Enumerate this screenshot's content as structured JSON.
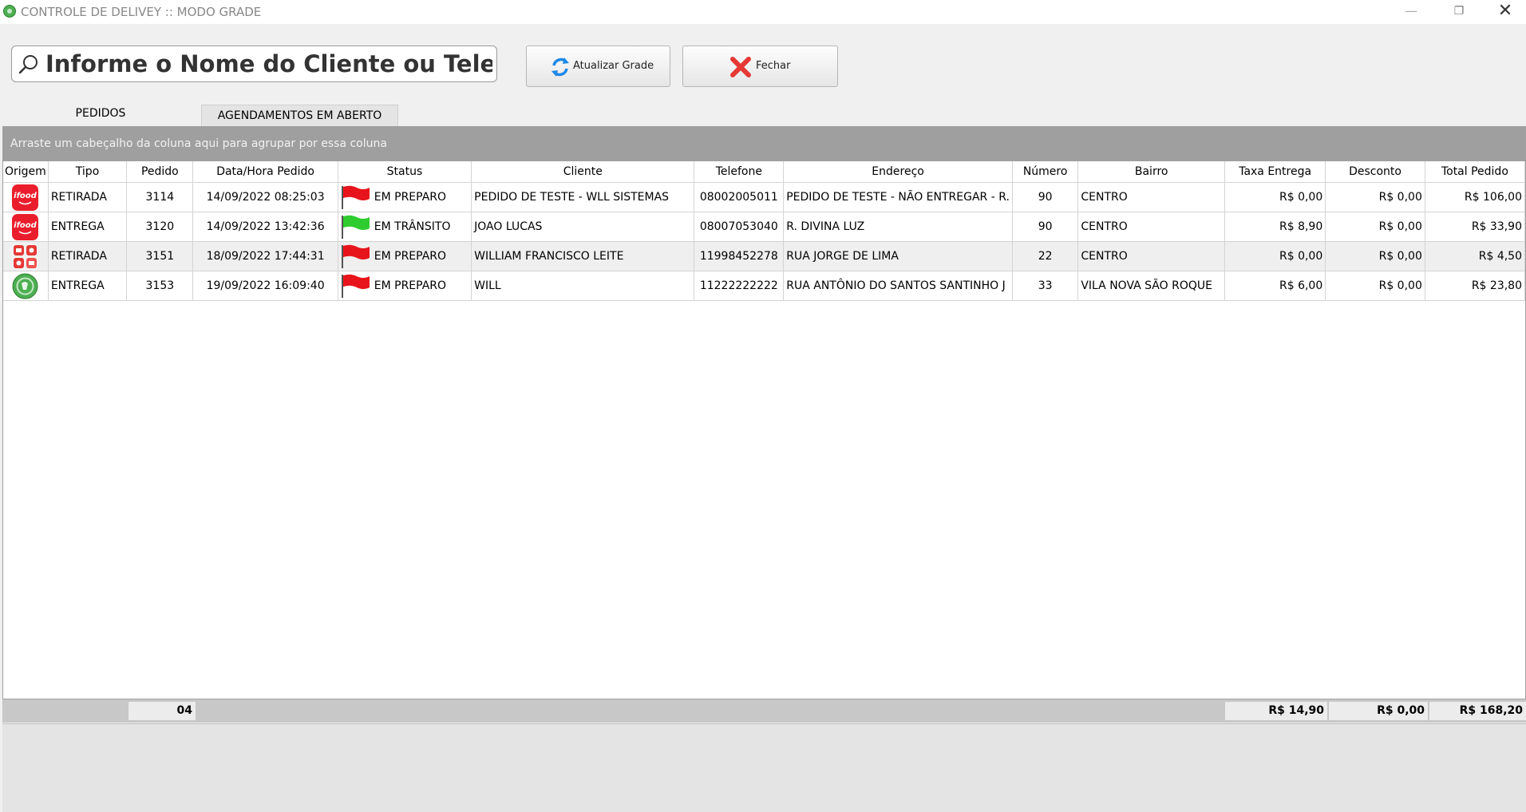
{
  "window": {
    "title": "CONTROLE DE DELIVEY :: MODO GRADE",
    "minimize": "—",
    "maximize": "❐",
    "close": "✕"
  },
  "toolbar": {
    "search_placeholder": "Informe o Nome do Cliente ou Telefone",
    "refresh_label": "Atualizar Grade",
    "close_label": "Fechar"
  },
  "tabs": [
    {
      "label": "PEDIDOS",
      "active": true
    },
    {
      "label": "AGENDAMENTOS EM ABERTO",
      "active": false
    }
  ],
  "grid": {
    "group_hint": "Arraste um cabeçalho da coluna aqui para agrupar por essa coluna",
    "columns": [
      "Origem",
      "Tipo",
      "Pedido",
      "Data/Hora Pedido",
      "Status",
      "Cliente",
      "Telefone",
      "Endereço",
      "Número",
      "Bairro",
      "Taxa Entrega",
      "Desconto",
      "Total Pedido"
    ],
    "rows": [
      {
        "origem_icon": "ifood-logo-icon",
        "tipo": "RETIRADA",
        "pedido": "3114",
        "data_hora": "14/09/2022 08:25:03",
        "status_flag": "red-flag-icon",
        "status": "EM PREPARO",
        "cliente": "PEDIDO DE TESTE - WLL SISTEMAS",
        "telefone": "08002005011",
        "endereco": "PEDIDO DE TESTE - NÃO ENTREGAR - R.",
        "numero": "90",
        "bairro": "CENTRO",
        "taxa": "R$ 0,00",
        "desconto": "R$ 0,00",
        "total": "R$ 106,00"
      },
      {
        "origem_icon": "ifood-logo-icon",
        "tipo": "ENTREGA",
        "pedido": "3120",
        "data_hora": "14/09/2022 13:42:36",
        "status_flag": "green-flag-icon",
        "status": "EM TRÂNSITO",
        "cliente": "JOAO LUCAS",
        "telefone": "08007053040",
        "endereco": "R. DIVINA LUZ",
        "numero": "90",
        "bairro": "CENTRO",
        "taxa": "R$ 8,90",
        "desconto": "R$ 0,00",
        "total": "R$ 33,90"
      },
      {
        "origem_icon": "delivery-app-icon",
        "tipo": "RETIRADA",
        "pedido": "3151",
        "data_hora": "18/09/2022 17:44:31",
        "status_flag": "red-flag-icon",
        "status": "EM PREPARO",
        "cliente": "WILLIAM FRANCISCO LEITE",
        "telefone": "11998452278",
        "endereco": "RUA JORGE DE LIMA",
        "numero": "22",
        "bairro": "CENTRO",
        "taxa": "R$ 0,00",
        "desconto": "R$ 0,00",
        "total": "R$ 4,50"
      },
      {
        "origem_icon": "green-circle-logo-icon",
        "tipo": "ENTREGA",
        "pedido": "3153",
        "data_hora": "19/09/2022 16:09:40",
        "status_flag": "red-flag-icon",
        "status": "EM PREPARO",
        "cliente": "WILL",
        "telefone": "11222222222",
        "endereco": "RUA ANTÔNIO DO SANTOS SANTINHO J",
        "numero": "33",
        "bairro": "VILA NOVA SÃO ROQUE",
        "taxa": "R$ 6,00",
        "desconto": "R$ 0,00",
        "total": "R$ 23,80"
      }
    ],
    "totals": {
      "pedido_count": "04",
      "taxa": "R$ 14,90",
      "desconto": "R$ 0,00",
      "total": "R$ 168,20"
    }
  },
  "colors": {
    "flag_red": "#e8141b",
    "flag_green": "#2ecc2e",
    "ifood_red": "#ea1d2c",
    "group_panel": "#9f9f9f"
  }
}
